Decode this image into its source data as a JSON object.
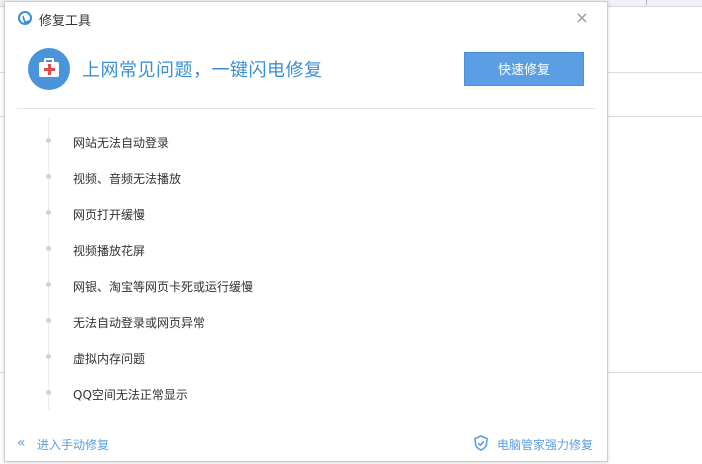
{
  "dialog": {
    "title": "修复工具",
    "close_glyph": "×",
    "headline": "上网常见问题，一键闪电修复",
    "quick_fix_label": "快速修复"
  },
  "issues": [
    "网站无法自动登录",
    "视频、音频无法播放",
    "网页打开缓慢",
    "视频播放花屏",
    "网银、淘宝等网页卡死或运行缓慢",
    "无法自动登录或网页异常",
    "虚拟内存问题",
    "QQ空间无法正常显示"
  ],
  "footer": {
    "manual_label": "进入手动修复",
    "pc_manager_label": "电脑管家强力修复"
  },
  "icons": {
    "app_logo": "app-logo-icon",
    "kit": "first-aid-kit-icon",
    "close": "close-icon",
    "manual": "double-chevron-left-icon",
    "pc_manager": "shield-icon"
  },
  "colors": {
    "accent": "#3b8fd9",
    "button": "#5c9ee3",
    "cross": "#e24b4b"
  }
}
